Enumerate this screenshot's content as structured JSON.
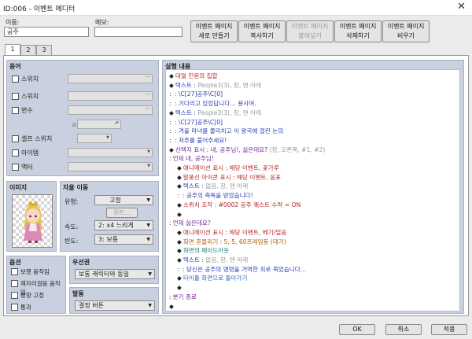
{
  "window": {
    "title": "ID:006 - 이벤트 에디터",
    "close": "✕"
  },
  "name": {
    "label": "이름:",
    "value": "공주"
  },
  "memo": {
    "label": "메모:",
    "value": ""
  },
  "toolbar": [
    {
      "l1": "이벤트 페이지",
      "l2": "새로 만들기"
    },
    {
      "l1": "이벤트 페이지",
      "l2": "복사하기"
    },
    {
      "l1": "이벤트 페이지",
      "l2": "붙여넣기"
    },
    {
      "l1": "이벤트 페이지",
      "l2": "삭제하기"
    },
    {
      "l1": "이벤트 페이지",
      "l2": "비우기"
    }
  ],
  "tabs": [
    "1",
    "2",
    "3"
  ],
  "conditions": {
    "title": "용어",
    "switch1": "스위치",
    "switch2": "스위치",
    "variable": "변수",
    "ge": "≥",
    "self_switch": "셀프 스위치",
    "item": "아이템",
    "actor": "액터"
  },
  "image": {
    "title": "이미지"
  },
  "autonomous": {
    "title": "자율 이동",
    "type_label": "유형:",
    "type_value": "고정",
    "route_button": "루트...",
    "speed_label": "속도:",
    "speed_value": "2: x4 느리게",
    "freq_label": "빈도:",
    "freq_value": "3: 보통"
  },
  "options": {
    "title": "옵션",
    "walking": "보행 움직임",
    "stepping": "제자리걸음 움직임",
    "direction_fix": "방향 고정",
    "through": "통과"
  },
  "priority": {
    "title": "우선권",
    "value": "보통 캐릭터와 동일"
  },
  "trigger": {
    "title": "발동",
    "value": "결정 버튼"
  },
  "contents": {
    "title": "실행 내용",
    "lines": [
      {
        "p": "◆",
        "t": "대열 인원의 집합",
        "c": "red",
        "i": 0
      },
      {
        "p": "◆",
        "t": "텍스트 : ",
        "t2": "People3(3), 창, 맨 아래",
        "c": "blue",
        "i": 0
      },
      {
        "p": ":",
        "t": "         : \\C[27]공주\\C[0]",
        "c": "blue",
        "i": 0
      },
      {
        "p": ":",
        "t": "         : 기다리고 있었답니다… 용사여.",
        "c": "blue",
        "i": 0
      },
      {
        "p": "◆",
        "t": "텍스트 : ",
        "t2": "People3(3), 창, 맨 아래",
        "c": "blue",
        "i": 0
      },
      {
        "p": ":",
        "t": "         : \\C[27]공주\\C[0]",
        "c": "blue",
        "i": 0
      },
      {
        "p": ":",
        "t": "         : 겨울 마녀를 물리치고 이 왕국에 걸린 눈의",
        "c": "blue",
        "i": 0
      },
      {
        "p": ":",
        "t": "         : 저주를 풀어주세요!",
        "c": "blue",
        "i": 0
      },
      {
        "p": "◆",
        "t": "선택지 표시 : 네, 공주님!, 싫은데요? ",
        "t2": "(창, 오른쪽, #1, #2)",
        "c": "purple",
        "i": 0
      },
      {
        "p": ":",
        "t": "언제 네, 공주님!",
        "c": "purple",
        "i": 0
      },
      {
        "p": "◆",
        "t": "애니메이션 표시 : 해당 이벤트, 꽃가루",
        "c": "red",
        "i": 1
      },
      {
        "p": "◆",
        "t": "말풍선 아이콘 표시 : 해당 이벤트, 음표",
        "c": "red",
        "i": 1
      },
      {
        "p": "◆",
        "t": "텍스트 : ",
        "t2": "없음, 창, 맨 아래",
        "c": "blue",
        "i": 1
      },
      {
        "p": ":",
        "t": "       : 공주의 축복을 받았습니다!",
        "c": "blue",
        "i": 1
      },
      {
        "p": "◆",
        "t": "스위치 조작 : #0002 공주 퀘스트 수락 = ON",
        "c": "red",
        "i": 1
      },
      {
        "p": "◆",
        "t": "",
        "c": "k",
        "i": 1
      },
      {
        "p": ":",
        "t": "언제 싫은데요?",
        "c": "purple",
        "i": 0
      },
      {
        "p": "◆",
        "t": "애니메이션 표시 : 해당 이벤트, 베기/얼음",
        "c": "red",
        "i": 1
      },
      {
        "p": "◆",
        "t": "화면 흔들리기 : 5, 5, 60프레임동 (대기)",
        "c": "orange",
        "i": 1
      },
      {
        "p": "◆",
        "t": "화면의 페이드아웃",
        "c": "teal",
        "i": 1
      },
      {
        "p": "◆",
        "t": "텍스트 : ",
        "t2": "없음, 창, 맨 아래",
        "c": "blue",
        "i": 1
      },
      {
        "p": ":",
        "t": "       : 당신은 공주의 명령을 거역한 죄로 죽었습니다…",
        "c": "blue",
        "i": 1
      },
      {
        "p": "◆",
        "t": "타이틀 화면으로 돌아가기",
        "c": "sky",
        "i": 1
      },
      {
        "p": "◆",
        "t": "",
        "c": "k",
        "i": 1
      },
      {
        "p": ":",
        "t": "분기 종료",
        "c": "purple",
        "i": 0
      },
      {
        "p": "◆",
        "t": "",
        "c": "k",
        "i": 0
      }
    ]
  },
  "footer": {
    "ok": "OK",
    "cancel": "취소",
    "apply": "적용"
  }
}
